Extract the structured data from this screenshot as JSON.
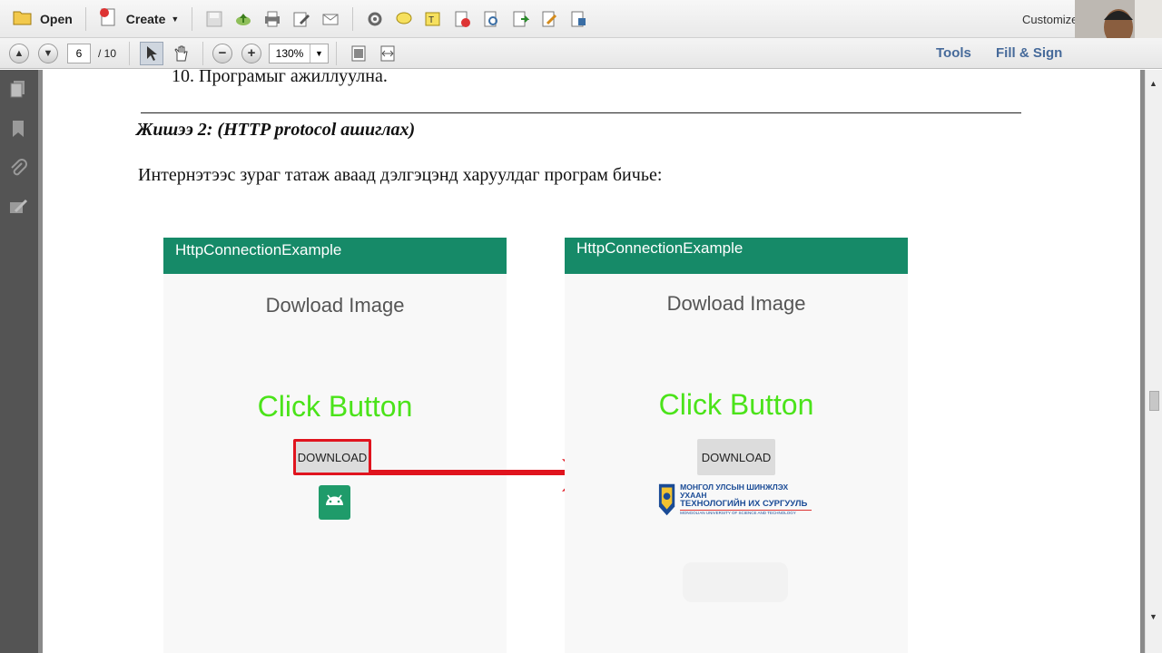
{
  "toolbar": {
    "open_label": "Open",
    "create_label": "Create",
    "customize_label": "Customize"
  },
  "nav": {
    "current_page": "6",
    "total_pages": "/ 10",
    "zoom": "130%"
  },
  "right_panel": {
    "tools_label": "Tools",
    "fill_sign_label": "Fill & Sign"
  },
  "document": {
    "list_item": "10. Програмыг ажиллуулна.",
    "example_heading": "Жишээ 2: (HTTP protocol ашиглах)",
    "description": "Интернэтээс зураг татаж аваад дэлгэцэнд харуулдаг програм бичье:",
    "left_screen": {
      "app_title": "HttpConnectionExample",
      "heading": "Dowload Image",
      "click_text": "Click Button",
      "button_label": "DOWNLOAD"
    },
    "right_screen": {
      "app_title": "HttpConnectionExample",
      "heading": "Dowload Image",
      "click_text": "Click Button",
      "button_label": "DOWNLOAD",
      "logo_line1": "МОНГОЛ УЛСЫН ШИНЖЛЭХ УХААН",
      "logo_line2": "ТЕХНОЛОГИЙН ИХ СУРГУУЛЬ",
      "logo_line3": "MONGOLIAN UNIVERSITY OF SCIENCE AND TECHNOLOGY"
    }
  },
  "colors": {
    "appbar": "#168a68",
    "click_text": "#4be31a",
    "highlight_red": "#e0141e"
  }
}
